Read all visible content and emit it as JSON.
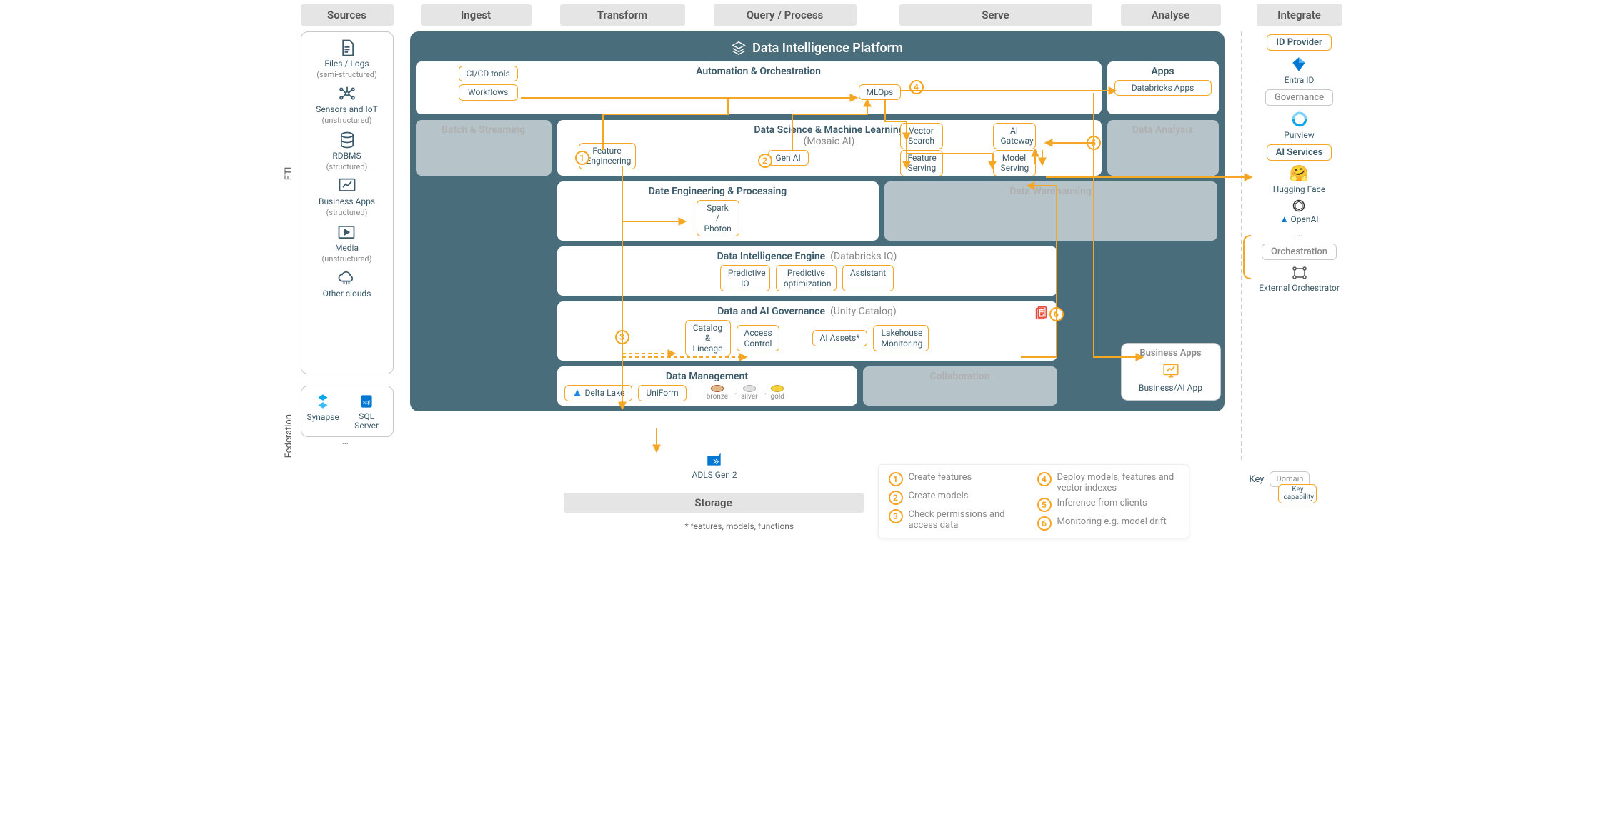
{
  "columns": {
    "sources": "Sources",
    "ingest": "Ingest",
    "transform": "Transform",
    "query": "Query / Process",
    "serve": "Serve",
    "analyse": "Analyse",
    "integrate": "Integrate",
    "storage": "Storage"
  },
  "side_labels": {
    "etl": "ETL",
    "federation": "Federation"
  },
  "sources": [
    {
      "title": "Files / Logs",
      "sub": "(semi-structured)"
    },
    {
      "title": "Sensors and IoT",
      "sub": "(unstructured)"
    },
    {
      "title": "RDBMS",
      "sub": "(structured)"
    },
    {
      "title": "Business Apps",
      "sub": "(structured)"
    },
    {
      "title": "Media",
      "sub": "(unstructured)"
    },
    {
      "title": "Other clouds",
      "sub": ""
    }
  ],
  "federation": {
    "synapse": "Synapse",
    "sqlserver": "SQL Server",
    "more": "…"
  },
  "platform_title": "Data Intelligence Platform",
  "panels": {
    "automation": {
      "title": "Automation & Orchestration",
      "caps": {
        "cicd": "CI/CD tools",
        "workflows": "Workflows",
        "mlops": "MLOps"
      }
    },
    "apps": {
      "title": "Apps",
      "caps": {
        "dbx_apps": "Databricks Apps"
      }
    },
    "batch": "Batch & Streaming",
    "dsml": {
      "title": "Data Science & Machine Learning",
      "sub": "(Mosaic AI)",
      "caps": {
        "feat_eng": "Feature Engineering",
        "genai": "Gen AI",
        "vector": "Vector Search",
        "feat_serve": "Feature Serving",
        "ai_gw": "AI Gateway",
        "model_serve": "Model Serving"
      }
    },
    "data_analysis": "Data Analysis",
    "de": {
      "title": "Date Engineering & Processing",
      "caps": {
        "spark": "Spark / Photon"
      }
    },
    "dw": "Data Warehousing",
    "die": {
      "title": "Data Intelligence Engine",
      "sub": "(Databricks IQ)",
      "caps": {
        "pio": "Predictive IO",
        "popt": "Predictive optimization",
        "assistant": "Assistant"
      }
    },
    "gov": {
      "title": "Data and AI Governance",
      "sub": "(Unity Catalog)",
      "caps": {
        "catalog": "Catalog & Lineage",
        "access": "Access Control",
        "assets": "AI Assets*",
        "monitor": "Lakehouse Monitoring"
      }
    },
    "dm": {
      "title": "Data Management",
      "caps": {
        "delta": "Delta Lake",
        "uniform": "UniForm"
      },
      "medallion": {
        "bronze": "bronze",
        "silver": "silver",
        "gold": "gold"
      }
    },
    "collab": "Collaboration"
  },
  "storage_item": "ADLS Gen 2",
  "business_apps": {
    "title": "Business Apps",
    "item": "Business/AI App"
  },
  "integrate": {
    "id_provider": "ID Provider",
    "entra": "Entra ID",
    "governance": "Governance",
    "purview": "Purview",
    "ai_services": "AI Services",
    "hf": "Hugging Face",
    "openai": "OpenAI",
    "more": "…",
    "orchestration": "Orchestration",
    "ext_orch": "External Orchestrator"
  },
  "legend": {
    "1": "Create features",
    "2": "Create models",
    "3": "Check permissions and access data",
    "4": "Deploy models, features and vector indexes",
    "5": "Inference from clients",
    "6": "Monitoring e.g. model drift"
  },
  "footnote": "* features, models, functions",
  "key": {
    "label": "Key",
    "domain": "Domain",
    "capability": "Key capability"
  }
}
